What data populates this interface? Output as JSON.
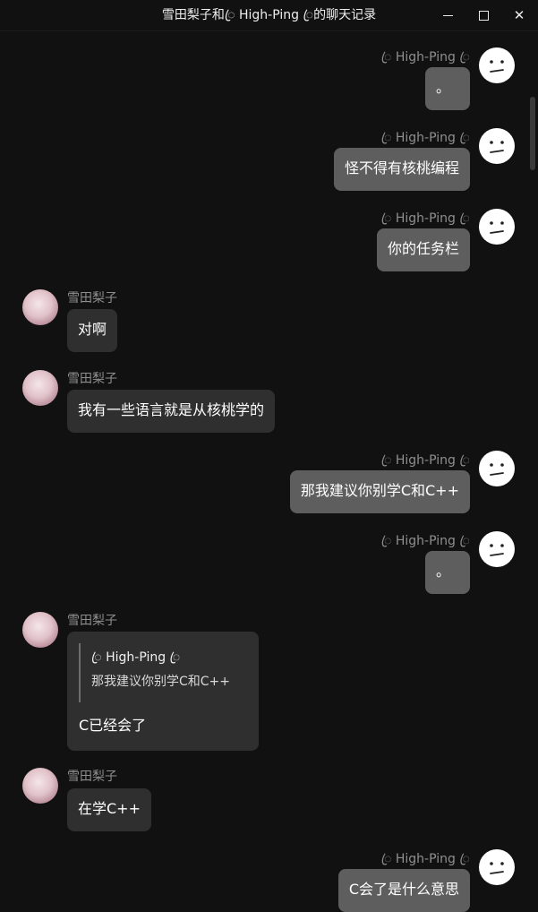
{
  "window": {
    "title": "雪田梨子和ꦿ High-Ping ꦿ的聊天记录",
    "minimize_glyph": "—",
    "close_glyph": "✕"
  },
  "users": {
    "me": "ꦿ High-Ping ꦿ",
    "her": "雪田梨子"
  },
  "messages": [
    {
      "sender": "me",
      "text": "。"
    },
    {
      "sender": "me",
      "text": "怪不得有核桃编程"
    },
    {
      "sender": "me",
      "text": "你的任务栏"
    },
    {
      "sender": "her",
      "text": "对啊"
    },
    {
      "sender": "her",
      "text": "我有一些语言就是从核桃学的"
    },
    {
      "sender": "me",
      "text": "那我建议你别学C和C++"
    },
    {
      "sender": "me",
      "text": "。"
    },
    {
      "sender": "her",
      "text": "C已经会了",
      "quote": {
        "author": "ꦿ High-Ping ꦿ",
        "text": "那我建议你别学C和C++"
      }
    },
    {
      "sender": "her",
      "text": "在学C++"
    },
    {
      "sender": "me",
      "text": "C会了是什么意思"
    }
  ],
  "colors": {
    "background": "#111111",
    "my_bubble": "#5e5e5e",
    "her_bubble": "#2f2f2f",
    "name_text": "#8f8f8f"
  }
}
